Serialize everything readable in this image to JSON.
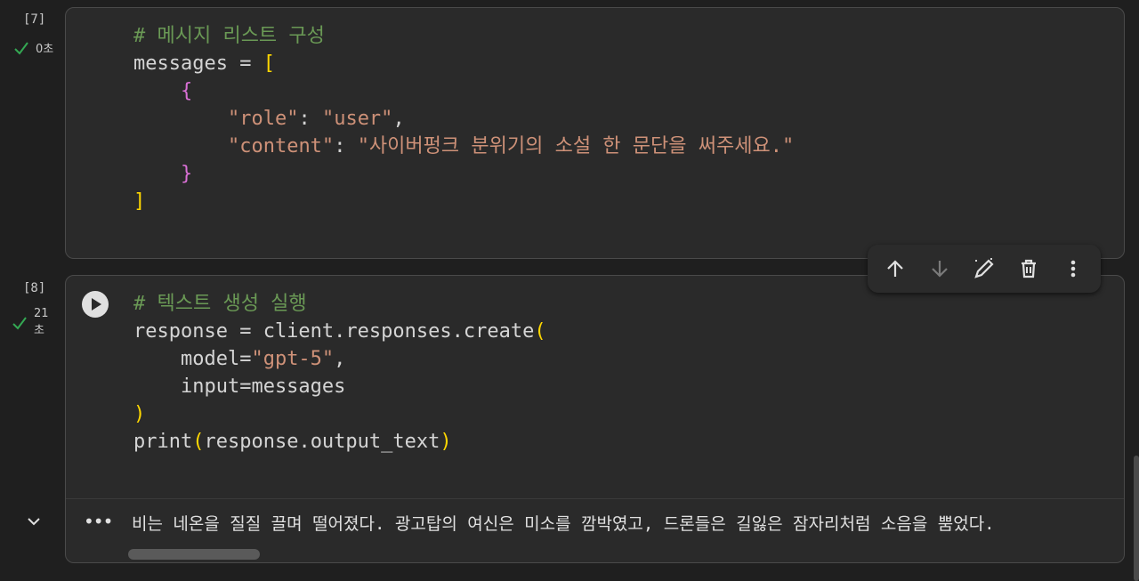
{
  "cells": [
    {
      "exec_count": "[7]",
      "status_time": "0초",
      "code_lines": [
        [
          {
            "t": "# 메시지 리스트 구성",
            "c": "c"
          }
        ],
        [
          {
            "t": "messages = "
          },
          {
            "t": "[",
            "c": "b1"
          }
        ],
        [
          {
            "t": "    "
          },
          {
            "t": "{",
            "c": "b2"
          }
        ],
        [
          {
            "t": "        "
          },
          {
            "t": "\"role\"",
            "c": "s"
          },
          {
            "t": ": "
          },
          {
            "t": "\"user\"",
            "c": "s"
          },
          {
            "t": ","
          }
        ],
        [
          {
            "t": "        "
          },
          {
            "t": "\"content\"",
            "c": "s"
          },
          {
            "t": ": "
          },
          {
            "t": "\"사이버펑크 분위기의 소설 한 문단을 써주세요.\"",
            "c": "s"
          }
        ],
        [
          {
            "t": "    "
          },
          {
            "t": "}",
            "c": "b2"
          }
        ],
        [
          {
            "t": "]",
            "c": "b1"
          }
        ]
      ]
    },
    {
      "exec_count": "[8]",
      "status_time": "21\n초",
      "code_lines": [
        [
          {
            "t": "# 텍스트 생성 실행",
            "c": "c"
          }
        ],
        [
          {
            "t": "response = client.responses.create"
          },
          {
            "t": "(",
            "c": "b1"
          }
        ],
        [
          {
            "t": "    model="
          },
          {
            "t": "\"gpt-5\"",
            "c": "s"
          },
          {
            "t": ","
          }
        ],
        [
          {
            "t": "    input=messages"
          }
        ],
        [
          {
            "t": ")",
            "c": "b1"
          }
        ],
        [
          {
            "t": "print"
          },
          {
            "t": "(",
            "c": "b1"
          },
          {
            "t": "response.output_text"
          },
          {
            "t": ")",
            "c": "b1"
          }
        ]
      ],
      "output_text": "비는 네온을 질질 끌며 떨어졌다. 광고탑의 여신은 미소를 깜박였고, 드론들은 길잃은 잠자리처럼 소음을 뿜었다."
    }
  ],
  "toolbar": {
    "icons": [
      "arrow-up-icon",
      "arrow-down-icon",
      "edit-magic-icon",
      "trash-icon",
      "more-vert-icon"
    ]
  },
  "colors": {
    "comment": "#6a9955",
    "string": "#ce9178",
    "bracket_level1": "#ffd700",
    "bracket_level2": "#da70d6",
    "check": "#34a853"
  }
}
